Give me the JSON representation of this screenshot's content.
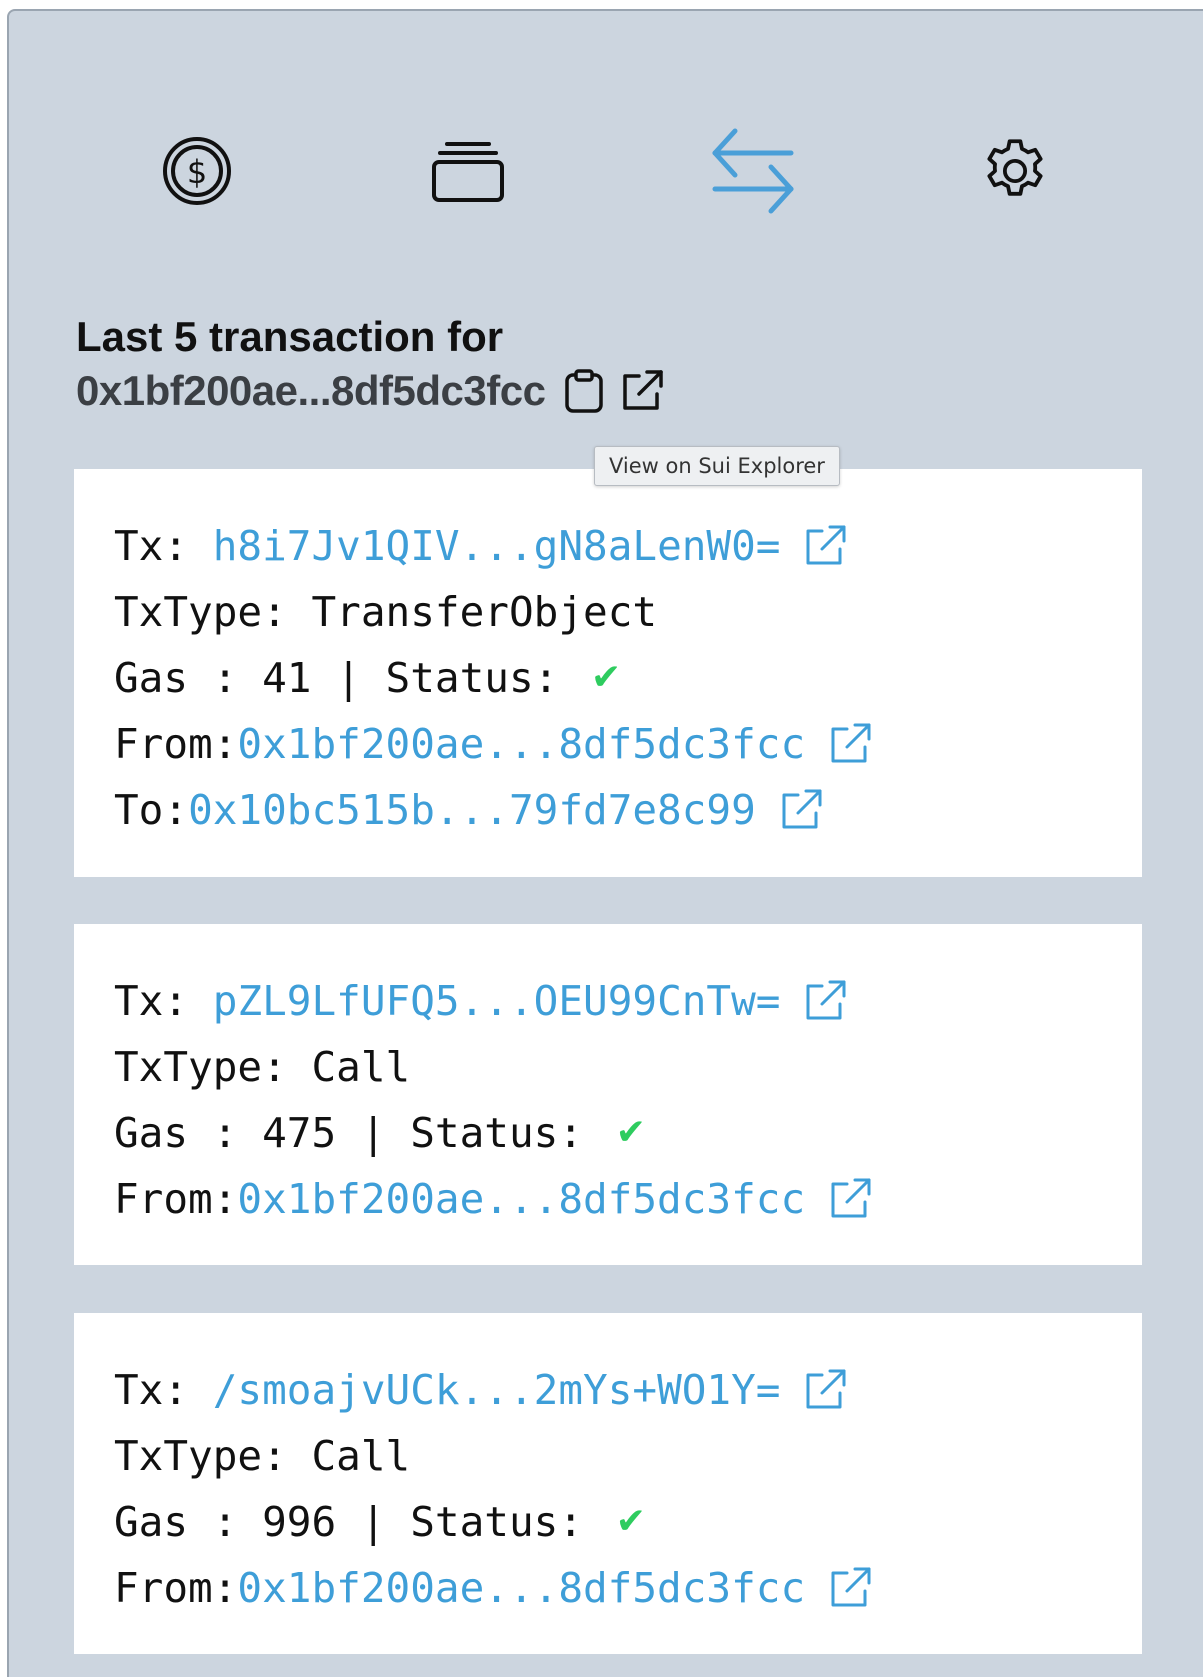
{
  "nav": {
    "items": [
      {
        "name": "coins",
        "icon": "dollar-coin-icon",
        "active": false
      },
      {
        "name": "nfts",
        "icon": "stack-cards-icon",
        "active": false
      },
      {
        "name": "transactions",
        "icon": "arrows-left-right-icon",
        "active": true
      },
      {
        "name": "settings",
        "icon": "gear-icon",
        "active": false
      }
    ],
    "active_color": "#4a9fd8",
    "inactive_color": "#111111"
  },
  "header": {
    "title": "Last 5 transaction for",
    "address": "0x1bf200ae...8df5dc3fcc",
    "copy_icon": "clipboard-icon",
    "explorer_icon": "external-link-icon"
  },
  "tooltip": {
    "text": "View on Sui Explorer"
  },
  "labels": {
    "tx": "Tx: ",
    "txtype": "TxType: ",
    "gas": "Gas : ",
    "status_sep": " | Status: ",
    "from": "From:",
    "to": "To:"
  },
  "status_icon": "✔",
  "transactions": [
    {
      "tx": "h8i7Jv1QIV...gN8aLenW0=",
      "type": "TransferObject",
      "gas": "41",
      "from": "0x1bf200ae...8df5dc3fcc",
      "to": "0x10bc515b...79fd7e8c99"
    },
    {
      "tx": "pZL9LfUFQ5...OEU99CnTw=",
      "type": "Call",
      "gas": "475",
      "from": "0x1bf200ae...8df5dc3fcc"
    },
    {
      "tx": "/smoajvUCk...2mYs+WO1Y=",
      "type": "Call",
      "gas": "996",
      "from": "0x1bf200ae...8df5dc3fcc"
    }
  ],
  "colors": {
    "background": "#ccd5df",
    "link": "#3e9ed8",
    "success": "#2ecc5f",
    "card": "#ffffff"
  }
}
